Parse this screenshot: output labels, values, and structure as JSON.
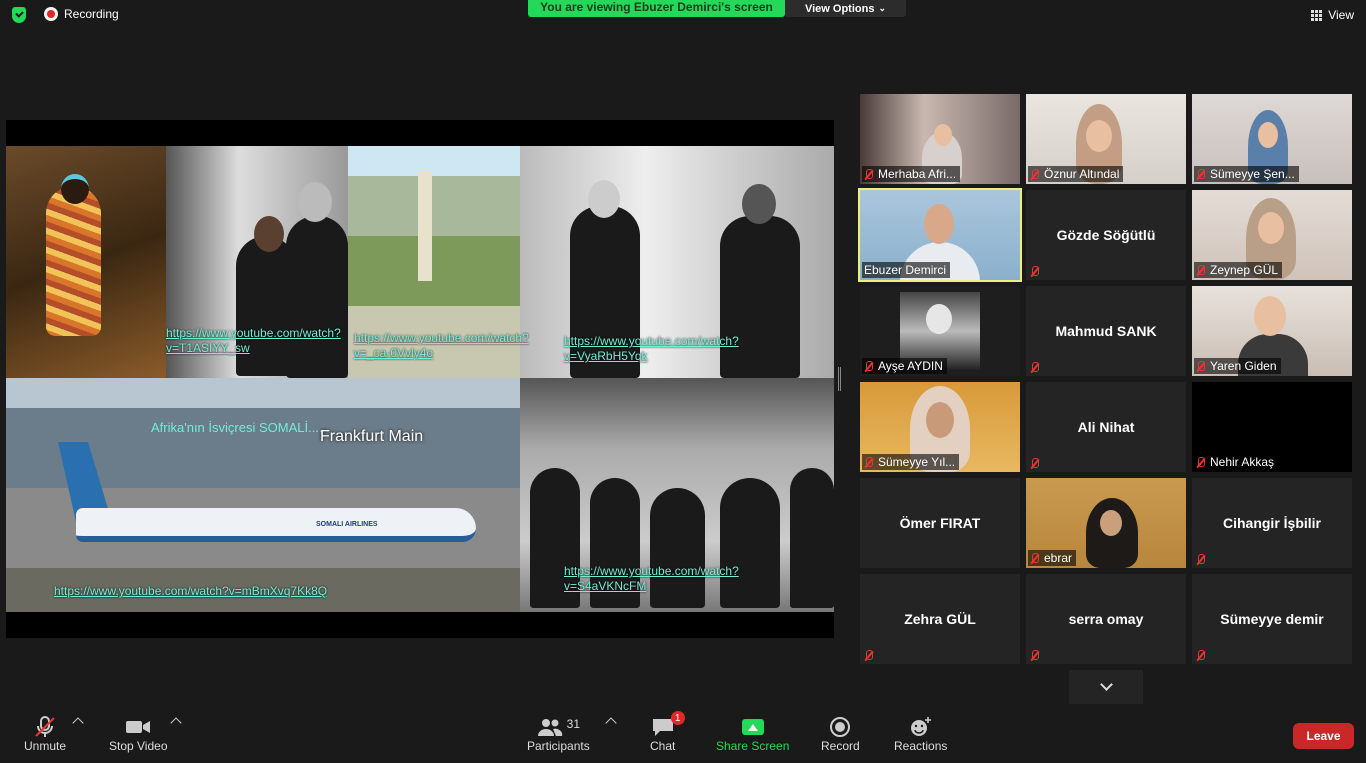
{
  "top": {
    "recording_label": "Recording",
    "viewing_banner": "You are viewing Ebuzer Demirci's screen",
    "view_options_label": "View Options",
    "view_label": "View"
  },
  "shared_screen": {
    "links": [
      "https://www.youtube.com/watch?v=T1ASIYY_sw",
      "https://www.youtube.com/watch?v=_ca-0Vvly4o",
      "https://www.youtube.com/watch?v=VyaRbH5Yqk",
      "https://www.youtube.com/watch?v=mBmXvq7Kk8Q",
      "https://www.youtube.com/watch?v=S4aVKNcFM"
    ],
    "title": "Afrika'nın İsviçresi SOMALİ....",
    "sign_text": "Frankfurt Main",
    "airline_text": "SOMALI AIRLINES"
  },
  "participants": [
    {
      "name": "Merhaba Afri...",
      "video": true,
      "muted": true
    },
    {
      "name": "Öznur Altındal",
      "video": true,
      "muted": true
    },
    {
      "name": "Sümeyye Şen...",
      "video": true,
      "muted": true
    },
    {
      "name": "Ebuzer Demirci",
      "video": true,
      "muted": false,
      "active": true
    },
    {
      "name": "Gözde Söğütlü",
      "video": false,
      "muted": true
    },
    {
      "name": "Zeynep GÜL",
      "video": true,
      "muted": true
    },
    {
      "name": "Ayşe AYDIN",
      "video": true,
      "muted": true
    },
    {
      "name": "Mahmud SANK",
      "video": false,
      "muted": true
    },
    {
      "name": "Yaren Giden",
      "video": true,
      "muted": true
    },
    {
      "name": "Sümeyye Yıl...",
      "video": true,
      "muted": true
    },
    {
      "name": "Ali Nihat",
      "video": false,
      "muted": true
    },
    {
      "name": "Nehir Akkaş",
      "video": true,
      "muted": true
    },
    {
      "name": "Ömer FIRAT",
      "video": false,
      "muted": false
    },
    {
      "name": "ebrar",
      "video": true,
      "muted": true
    },
    {
      "name": "Cihangir İşbilir",
      "video": false,
      "muted": true
    },
    {
      "name": "Zehra GÜL",
      "video": false,
      "muted": true
    },
    {
      "name": "serra omay",
      "video": false,
      "muted": true
    },
    {
      "name": "Sümeyye demir",
      "video": false,
      "muted": true
    }
  ],
  "toolbar": {
    "unmute": "Unmute",
    "stop_video": "Stop Video",
    "participants": "Participants",
    "participants_count": "31",
    "chat": "Chat",
    "chat_badge": "1",
    "share_screen": "Share Screen",
    "record": "Record",
    "reactions": "Reactions",
    "leave": "Leave"
  },
  "colors": {
    "green": "#23d959",
    "active_outline": "#ecf07a",
    "leave_red": "#c92828",
    "link_cyan": "#6ef0d6"
  }
}
